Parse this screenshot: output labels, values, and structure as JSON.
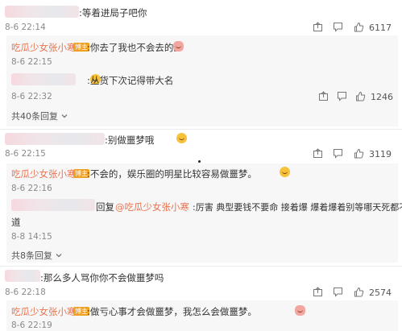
{
  "comments": [
    {
      "suffix": ":等着进局子吧你",
      "time": "8-6 22:14",
      "likes": "6117"
    },
    {
      "suffix": ":别做噩梦哦",
      "time": "8-6 22:15",
      "likes": "3119"
    },
    {
      "suffix": ":那么多人骂你你不会做噩梦吗",
      "time": "8-6 22:18",
      "likes": "2574"
    }
  ],
  "replies": [
    {
      "author": "吃瓜少女张小寒",
      "badge": "博主",
      "text": ":你去了我也不会去的。",
      "time": "8-6 22:15"
    },
    {
      "text": ":丛货下次记得带大名",
      "time": "8-6 22:32",
      "likes": "1246"
    },
    {
      "author": "吃瓜少女张小寒",
      "badge": "博主",
      "text": ":不会的，娱乐圈的明星比较容易做噩梦。",
      "time": "8-6 22:16"
    },
    {
      "reply_word": "回复",
      "mention": "@吃瓜少女张小寒",
      "text_line1": ":厉害 典型要钱不要命 接着爆 爆着爆着别等哪天死都不知",
      "text_line2": "道",
      "time": "8-8 14:15"
    },
    {
      "author": "吃瓜少女张小寒",
      "badge": "博主",
      "text": ":做亏心事才会做噩梦，我怎么会做噩梦。",
      "time": "8-6 22:19"
    }
  ],
  "more_replies": [
    "共40条回复",
    "共8条回复"
  ],
  "icons": [
    "share-icon",
    "comment-icon",
    "like-icon"
  ]
}
